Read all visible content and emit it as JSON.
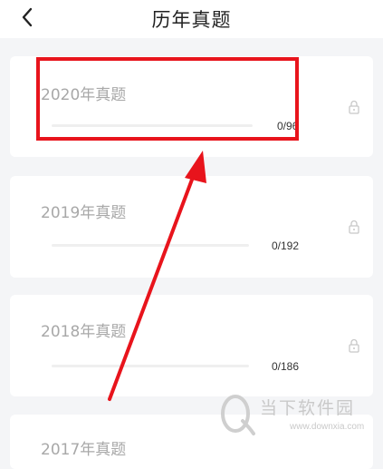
{
  "header": {
    "title": "历年真题",
    "back_icon": "chevron-left-icon"
  },
  "papers": [
    {
      "title": "2020年真题",
      "done": 0,
      "total": 96,
      "progress_text": "0/96",
      "progress": 0,
      "icon": "lock-icon"
    },
    {
      "title": "2019年真题",
      "done": 0,
      "total": 192,
      "progress_text": "0/192",
      "progress": 0,
      "icon": "lock-icon"
    },
    {
      "title": "2018年真题",
      "done": 0,
      "total": 186,
      "progress_text": "0/186",
      "progress": 0,
      "icon": "lock-icon"
    },
    {
      "title": "2017年真题"
    }
  ],
  "annotation": {
    "color": "#e8141c"
  },
  "watermark": {
    "brand": "当下软件园",
    "url": "www.downxia.com"
  }
}
